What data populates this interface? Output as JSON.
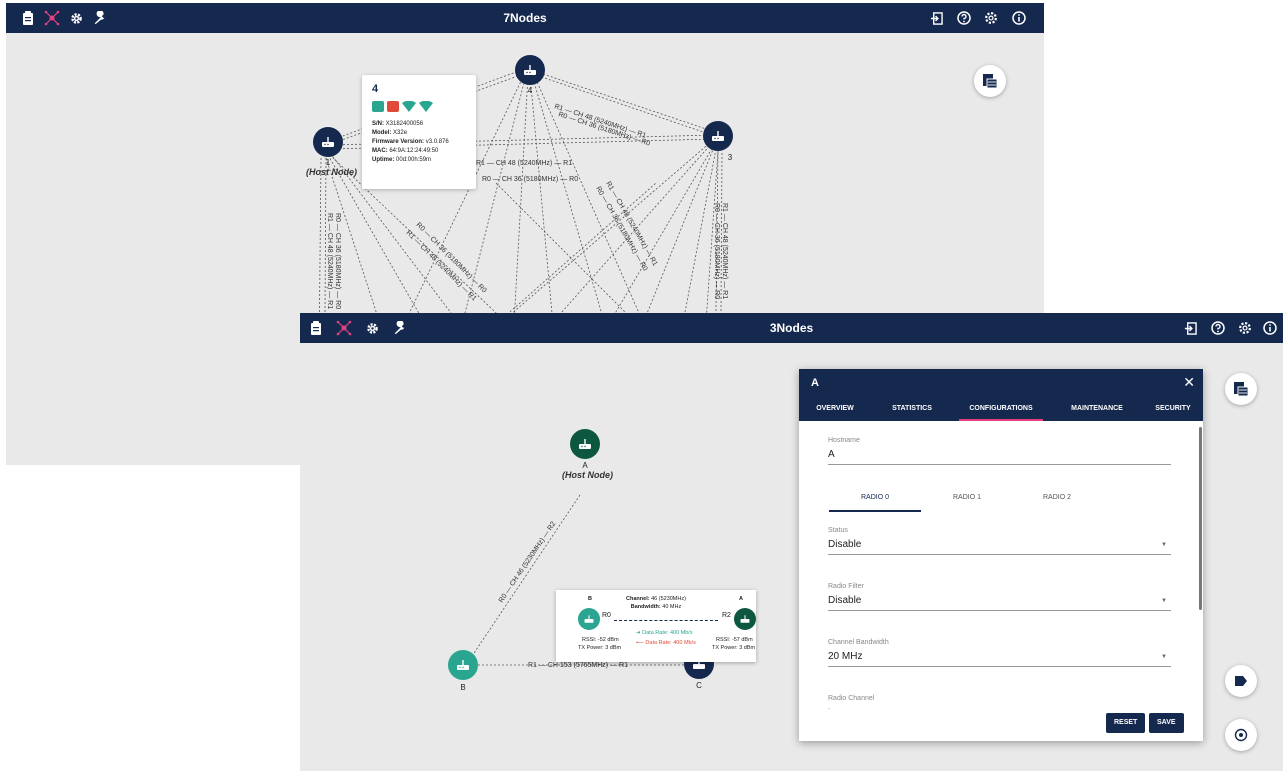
{
  "window_back": {
    "title": "7Nodes",
    "tooltip": {
      "node": "4",
      "sn_label": "S/N:",
      "sn_value": "X3182400056",
      "model_label": "Model:",
      "model_value": "X32e",
      "fw_label": "Firmware Version:",
      "fw_value": "v3.0.876",
      "mac_label": "MAC:",
      "mac_value": "64:9A:12:24:49:50",
      "uptime_label": "Uptime:",
      "uptime_value": "00d:00h:59m"
    },
    "nodes": {
      "n1": "1",
      "n1_host": "(Host Node)",
      "n4": "4",
      "n3": "3"
    },
    "link_labels": {
      "l1": "R1 — CH 48 (5240MHz) — R1",
      "l2": "R0 — CH 36 (5180MHz) — R0",
      "l3": "R1 — CH 48 (5240MHz) — R1",
      "l4": "R0 — CH 36 (5180MHz) — R0",
      "l5": "R1 — CH 48 (5240MHz) — R1",
      "l6": "R0 — CH 36 (5180MHz) — R0",
      "l7": "R0 — CH 36 (5180MHz) — R0",
      "l8": "R1 — CH 48 (5240MHz) — R1"
    }
  },
  "window_front": {
    "title": "3Nodes",
    "nodes": {
      "a": "A",
      "a_host": "(Host Node)",
      "b": "B",
      "c": "C"
    },
    "links": {
      "ab": "R0 — CH 46 (5230MHz) — R2",
      "bc": "R1 — CH 153 (5765MHz) — R1"
    },
    "link_card": {
      "left_node": "B",
      "right_node": "A",
      "channel_label": "Channel:",
      "channel_value": "46 (5230MHz)",
      "bw_label": "Bandwidth:",
      "bw_value": "40 MHz",
      "left_radio": "R0",
      "right_radio": "R2",
      "rate_up": "Data Rate: 400 Mb/s",
      "rate_down": "Data Rate: 400 Mb/s",
      "left_rssi": "RSSI: -52 dBm",
      "left_tx": "TX Power: 3 dBm",
      "right_rssi": "RSSI: -57 dBm",
      "right_tx": "TX Power: 3 dBm"
    },
    "dialog": {
      "title": "A",
      "close": "✕",
      "tabs": [
        "OVERVIEW",
        "STATISTICS",
        "CONFIGURATIONS",
        "MAINTENANCE",
        "SECURITY"
      ],
      "hostname_label": "Hostname",
      "hostname_value": "A",
      "radio_tabs": [
        "RADIO 0",
        "RADIO 1",
        "RADIO 2"
      ],
      "status_label": "Status",
      "status_value": "Disable",
      "filter_label": "Radio Filter",
      "filter_value": "Disable",
      "bw_label": "Channel Bandwidth",
      "bw_value": "20 MHz",
      "channel_label": "Radio Channel",
      "channel_value": "-",
      "reset": "RESET",
      "save": "SAVE"
    }
  },
  "colors": {
    "navy": "#15294f",
    "pink": "#e54080",
    "teal": "#2aa58f",
    "dark_green": "#0d5640",
    "background": "#e9e9e9"
  },
  "icons": [
    "clipboard-icon",
    "topology-icon",
    "gear-icon",
    "wrench-icon",
    "logout-icon",
    "help-icon",
    "settings-icon",
    "info-icon",
    "table-icon",
    "label-icon",
    "target-icon"
  ]
}
